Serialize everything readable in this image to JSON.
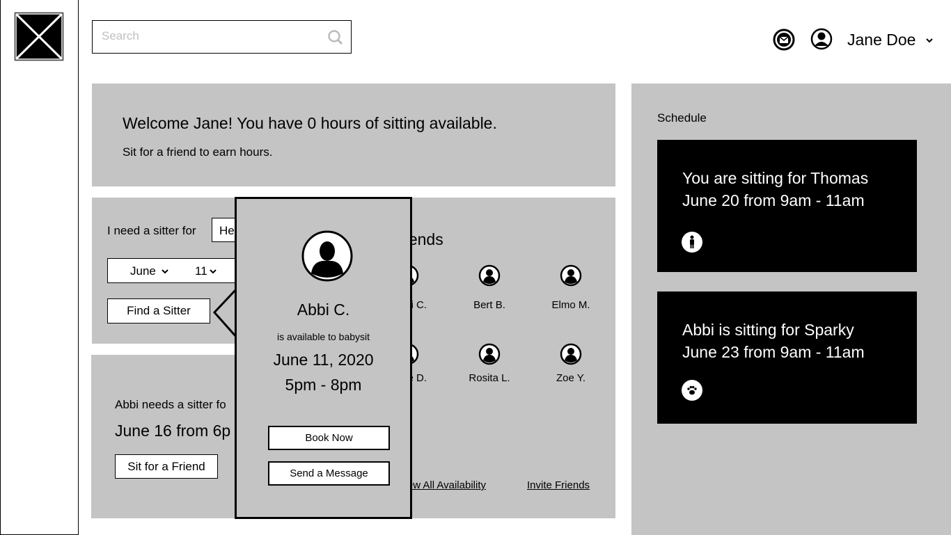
{
  "header": {
    "search_placeholder": "Search",
    "user_name": "Jane Doe",
    "icons": [
      "logo-placeholder",
      "search-icon",
      "mail-icon",
      "user-avatar-icon",
      "chevron-down-icon"
    ]
  },
  "welcome": {
    "title": "Welcome Jane! You have 0 hours of sitting available.",
    "subtitle": "Sit for a friend to earn hours."
  },
  "find_sitter": {
    "label": "I need a sitter for",
    "select_value": "He",
    "month": "June",
    "day": "11",
    "button": "Find a Sitter"
  },
  "friend_request": {
    "text": "Abbi needs a sitter fo",
    "when": "June 16 from 6p",
    "button": "Sit for a Friend"
  },
  "friends": {
    "heading": "Friends",
    "items": [
      {
        "name": "i C."
      },
      {
        "name": "Bert B."
      },
      {
        "name": "Elmo M."
      },
      {
        "name": "e D."
      },
      {
        "name": "Rosita L."
      },
      {
        "name": "Zoe Y."
      }
    ],
    "view_all": "View All Availability",
    "invite": "Invite Friends"
  },
  "popup": {
    "name": "Abbi C.",
    "status": "is available to babysit",
    "date": "June 11, 2020",
    "time": "5pm - 8pm",
    "book": "Book Now",
    "message": "Send a Message"
  },
  "schedule": {
    "title": "Schedule",
    "items": [
      {
        "line1": "You are sitting for Thomas",
        "line2": "June 20 from 9am - 11am",
        "icon": "child-icon"
      },
      {
        "line1": "Abbi is sitting for Sparky",
        "line2": "June 23 from 9am - 11am",
        "icon": "paw-icon"
      }
    ]
  },
  "colors": {
    "panel": "#c4c4c4",
    "card": "#000000"
  }
}
